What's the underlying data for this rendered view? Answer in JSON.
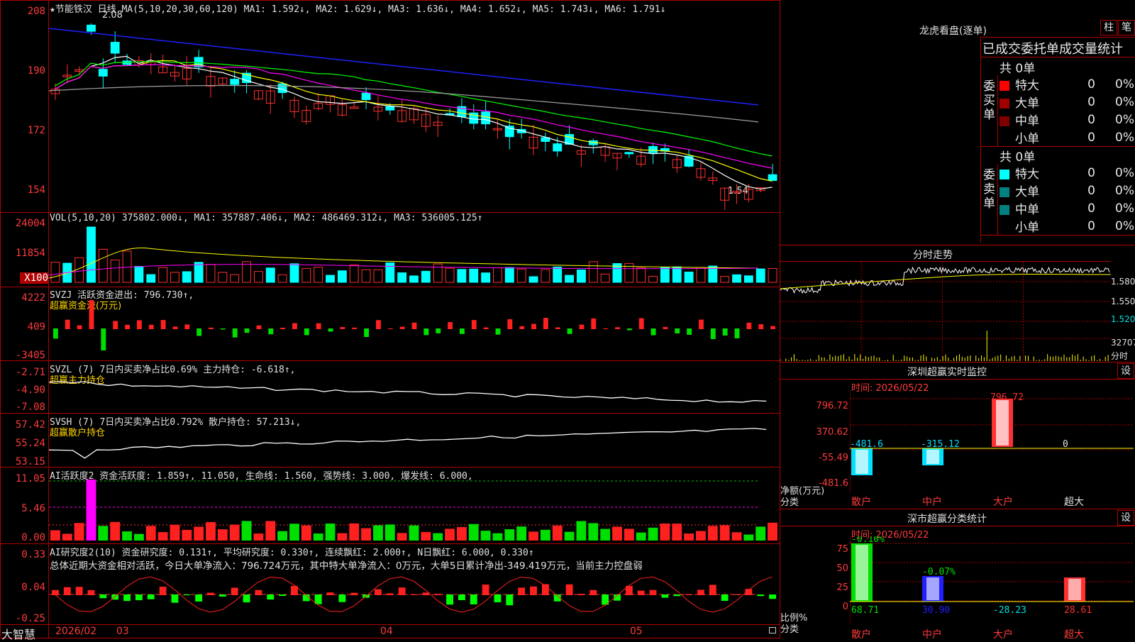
{
  "app": {
    "name": "大智慧"
  },
  "main": {
    "stock_header": "★节能铁汉 日线 MA(5,10,20,30,60,120) MA1: 1.592↓, MA2: 1.629↓, MA3: 1.636↓, MA4: 1.652↓, MA5: 1.743↓, MA6: 1.791↓",
    "price_axis": [
      "208",
      "190",
      "172",
      "154"
    ],
    "high_marker": "2.08",
    "low_marker": "1.54",
    "vol_header": "VOL(5,10,20) 375802.000↓, MA1: 357887.406↓, MA2: 486469.312↓, MA3: 536005.125↑",
    "vol_axis": [
      "24004",
      "11854",
      "X100"
    ],
    "svzj_header": "SVZJ  活跃资金进出: 796.730↑,",
    "svzj_sub": "超赢资金流(万元)",
    "svzj_axis": [
      "4222",
      "409",
      "-3405"
    ],
    "svzl_header": "SVZL (7) 7日内买卖净占比0.69% 主力持仓: -6.618↑,",
    "svzl_sub": "超赢主力持仓",
    "svzl_axis": [
      "-2.71",
      "-4.90",
      "-7.08"
    ],
    "svsh_header": "SVSH (7) 7日内买卖净占比0.792% 散户持仓: 57.213↓,",
    "svsh_sub": "超赢散户持仓",
    "svsh_axis": [
      "57.42",
      "55.24",
      "53.15"
    ],
    "ai1_header": "AI活跃度2 资金活跃度: 1.859↑, 11.050, 生命线: 1.560, 强势线: 3.000, 爆发线: 6.000,",
    "ai1_axis": [
      "11.05",
      "5.46",
      "0.00"
    ],
    "ai2_header": "AI研究度2(10) 资金研究度: 0.131↑, 平均研究度: 0.330↑, 连续飘红: 2.000↑, N日飘红: 6.000, 0.330↑",
    "ai2_text": "总体近期大资金相对活跃，今日大单净流入：796.724万元，其中特大单净流入：0万元，大单5日累计净出-349.419万元，当前主力控盘弱",
    "ai2_axis": [
      "0.33",
      "0.04",
      "-0.25"
    ],
    "date_axis": [
      "2026/02",
      "03",
      "04",
      "05"
    ]
  },
  "dragon": {
    "title": "龙虎看盘(逐单)",
    "btn_zhu": "柱",
    "btn_bi": "笔",
    "subtitle": "已成交委托单成交量统计",
    "buy_label": "委买单",
    "sell_label": "委卖单",
    "buy_total": "共 0单",
    "sell_total": "共 0单",
    "buy_rows": [
      {
        "name": "特大",
        "n": "0",
        "p": "0%"
      },
      {
        "name": "大单",
        "n": "0",
        "p": "0%"
      },
      {
        "name": "中单",
        "n": "0",
        "p": "0%"
      },
      {
        "name": "小单",
        "n": "0",
        "p": "0%"
      }
    ],
    "sell_rows": [
      {
        "name": "特大",
        "n": "0",
        "p": "0%"
      },
      {
        "name": "大单",
        "n": "0",
        "p": "0%"
      },
      {
        "name": "中单",
        "n": "0",
        "p": "0%"
      },
      {
        "name": "小单",
        "n": "0",
        "p": "0%"
      }
    ],
    "colors": {
      "buy": [
        "#ff0000",
        "#a00000",
        "#800000",
        "#000000"
      ],
      "sell": [
        "#00ffff",
        "#008080",
        "#008080",
        "#000000"
      ]
    }
  },
  "intraday": {
    "title": "分时走势",
    "axis": [
      "1.580",
      "1.550",
      "1.520",
      "32707"
    ],
    "unit": "分时"
  },
  "sz_monitor": {
    "title": "深圳超赢实时监控",
    "btn": "设",
    "time": "时间: 2026/05/22",
    "axis": [
      "796.72",
      "370.62",
      "-55.49",
      "-481.6"
    ],
    "side_label": "净额(万元)",
    "cat_label": "分类",
    "cats": [
      "散户",
      "中户",
      "大户",
      "超大"
    ],
    "values": [
      "-481.6",
      "-315.12",
      "796.72",
      "0"
    ]
  },
  "sz_class": {
    "title": "深市超赢分类统计",
    "btn": "设",
    "time": "时间: 2026/05/22",
    "axis": [
      "75",
      "50",
      "25",
      "0"
    ],
    "side_label": "比例%",
    "cat_label": "分类",
    "cats": [
      "散户",
      "中户",
      "大户",
      "超大"
    ],
    "top_values": [
      "-0.10%",
      "-0.07%"
    ],
    "values": [
      "68.71",
      "30.90",
      "-28.23",
      "28.61"
    ]
  }
}
